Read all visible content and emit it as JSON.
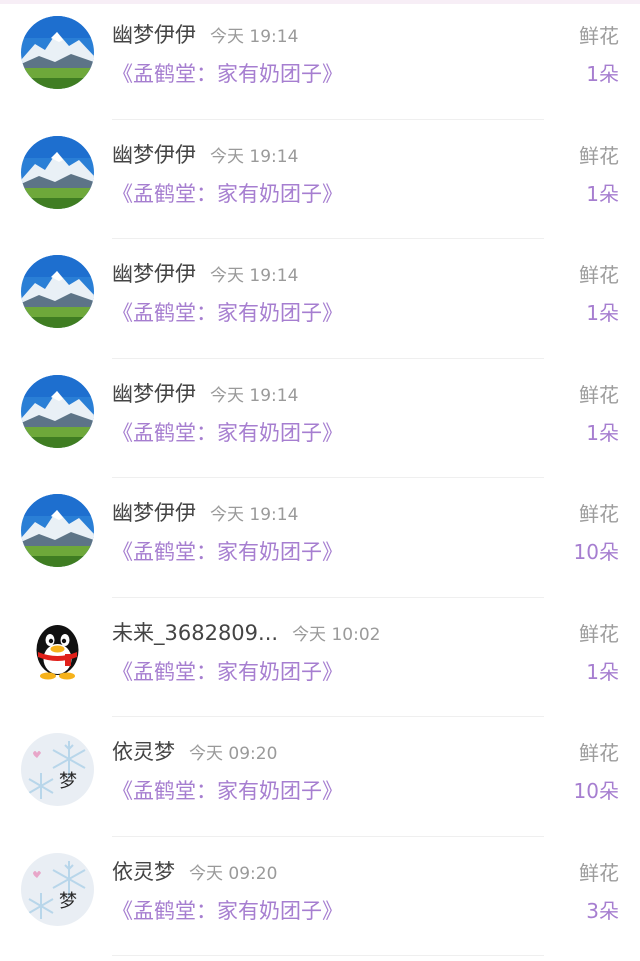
{
  "records": [
    {
      "name": "幽梦伊伊",
      "time": "今天 19:14",
      "book": "《孟鹤堂：家有奶团子》",
      "type": "鲜花",
      "count": "1朵",
      "avatar": "mountain-avatar"
    },
    {
      "name": "幽梦伊伊",
      "time": "今天 19:14",
      "book": "《孟鹤堂：家有奶团子》",
      "type": "鲜花",
      "count": "1朵",
      "avatar": "mountain-avatar"
    },
    {
      "name": "幽梦伊伊",
      "time": "今天 19:14",
      "book": "《孟鹤堂：家有奶团子》",
      "type": "鲜花",
      "count": "1朵",
      "avatar": "mountain-avatar"
    },
    {
      "name": "幽梦伊伊",
      "time": "今天 19:14",
      "book": "《孟鹤堂：家有奶团子》",
      "type": "鲜花",
      "count": "1朵",
      "avatar": "mountain-avatar"
    },
    {
      "name": "幽梦伊伊",
      "time": "今天 19:14",
      "book": "《孟鹤堂：家有奶团子》",
      "type": "鲜花",
      "count": "10朵",
      "avatar": "mountain-avatar"
    },
    {
      "name": "未来_3682809...",
      "time": "今天 10:02",
      "book": "《孟鹤堂：家有奶团子》",
      "type": "鲜花",
      "count": "1朵",
      "avatar": "penguin-avatar"
    },
    {
      "name": "依灵梦",
      "time": "今天 09:20",
      "book": "《孟鹤堂：家有奶团子》",
      "type": "鲜花",
      "count": "10朵",
      "avatar": "snowflake-avatar"
    },
    {
      "name": "依灵梦",
      "time": "今天 09:20",
      "book": "《孟鹤堂：家有奶团子》",
      "type": "鲜花",
      "count": "3朵",
      "avatar": "snowflake-avatar"
    }
  ],
  "avatar_text": {
    "snowflake_char": "梦"
  },
  "colors": {
    "accent": "#a67ed0",
    "name": "#444444",
    "muted": "#9a9a9a",
    "divider": "#efefef"
  }
}
